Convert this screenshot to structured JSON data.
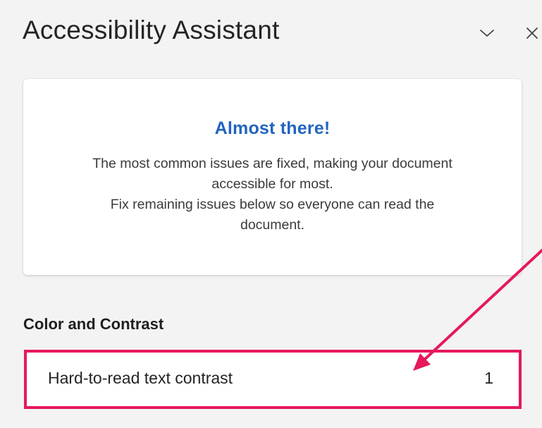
{
  "pane": {
    "title": "Accessibility Assistant",
    "collapse_icon": "chevron-down-icon",
    "close_icon": "close-icon"
  },
  "status_card": {
    "heading": "Almost there!",
    "lines": [
      "The most common issues are fixed, making your document",
      "accessible for most.",
      "Fix remaining issues below so everyone can read the",
      "document."
    ]
  },
  "sections": [
    {
      "title": "Color and Contrast",
      "issues": [
        {
          "label": "Hard-to-read text contrast",
          "count": "1"
        }
      ]
    }
  ],
  "colors": {
    "heading_blue": "#2364c0",
    "highlight_pink": "#e5195c",
    "pane_background": "#f3f3f3"
  }
}
